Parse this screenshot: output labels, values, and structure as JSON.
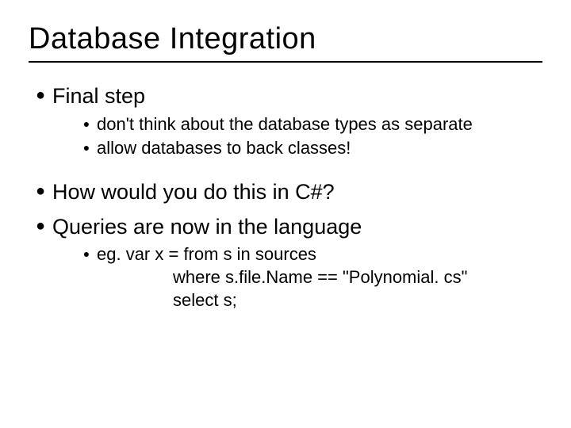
{
  "title": "Database Integration",
  "items": [
    {
      "text": "Final step",
      "sub": [
        {
          "text": "don't think about the database types as separate"
        },
        {
          "text": "allow databases to back classes!"
        }
      ]
    },
    {
      "text": "How would you do this in C#?",
      "sub": []
    },
    {
      "text": "Queries are now in the language",
      "sub": [
        {
          "text": "eg. var x = from s in sources",
          "cont": [
            "where s.file.Name == \"Polynomial. cs\"",
            "select s;"
          ]
        }
      ]
    }
  ]
}
